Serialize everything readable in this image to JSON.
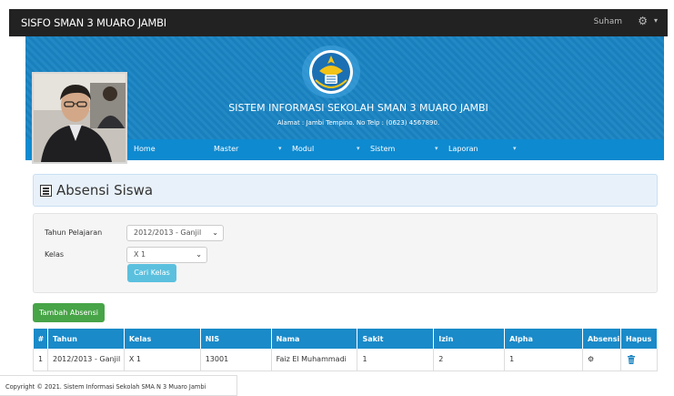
{
  "app": {
    "brand": "SISFO SMAN 3 MUARO JAMBI",
    "user": "Suham"
  },
  "header": {
    "title": "SISTEM INFORMASI SEKOLAH SMAN 3 MUARO JAMBI",
    "subtitle": "Alamat : Jambi Tempino. No Telp : (0623) 4567890."
  },
  "menu": {
    "items": [
      {
        "label": "Home",
        "dropdown": false
      },
      {
        "label": "Master",
        "dropdown": true
      },
      {
        "label": "Modul",
        "dropdown": true
      },
      {
        "label": "Sistem",
        "dropdown": true
      },
      {
        "label": "Laporan",
        "dropdown": true
      }
    ]
  },
  "page": {
    "title": "Absensi Siswa"
  },
  "form": {
    "tahun_label": "Tahun Pelajaran",
    "tahun_value": "2012/2013 - Ganjil",
    "kelas_label": "Kelas",
    "kelas_value": "X 1",
    "search_button": "Cari Kelas"
  },
  "actions": {
    "add_button": "Tambah Absensi"
  },
  "table": {
    "columns": [
      "#",
      "Tahun",
      "Kelas",
      "NIS",
      "Nama",
      "Sakit",
      "Izin",
      "Alpha",
      "Absensi",
      "Hapus"
    ],
    "rows": [
      {
        "no": "1",
        "tahun": "2012/2013 - Ganjil",
        "kelas": "X 1",
        "nis": "13001",
        "nama": "Faiz El Muhammadi",
        "sakit": "1",
        "izin": "2",
        "alpha": "1",
        "absensi_icon": "gear-icon",
        "hapus_icon": "trash-icon"
      }
    ]
  },
  "footer": {
    "text": "Copyright © 2021. Sistem Informasi Sekolah SMA N 3 Muaro Jambi"
  },
  "colors": {
    "topbar": "#222222",
    "banner": "#1a84c3",
    "menubar": "#0e8ad0",
    "table_header": "#1a8ac9",
    "primary_info": "#5bc0de",
    "success": "#47a447"
  }
}
